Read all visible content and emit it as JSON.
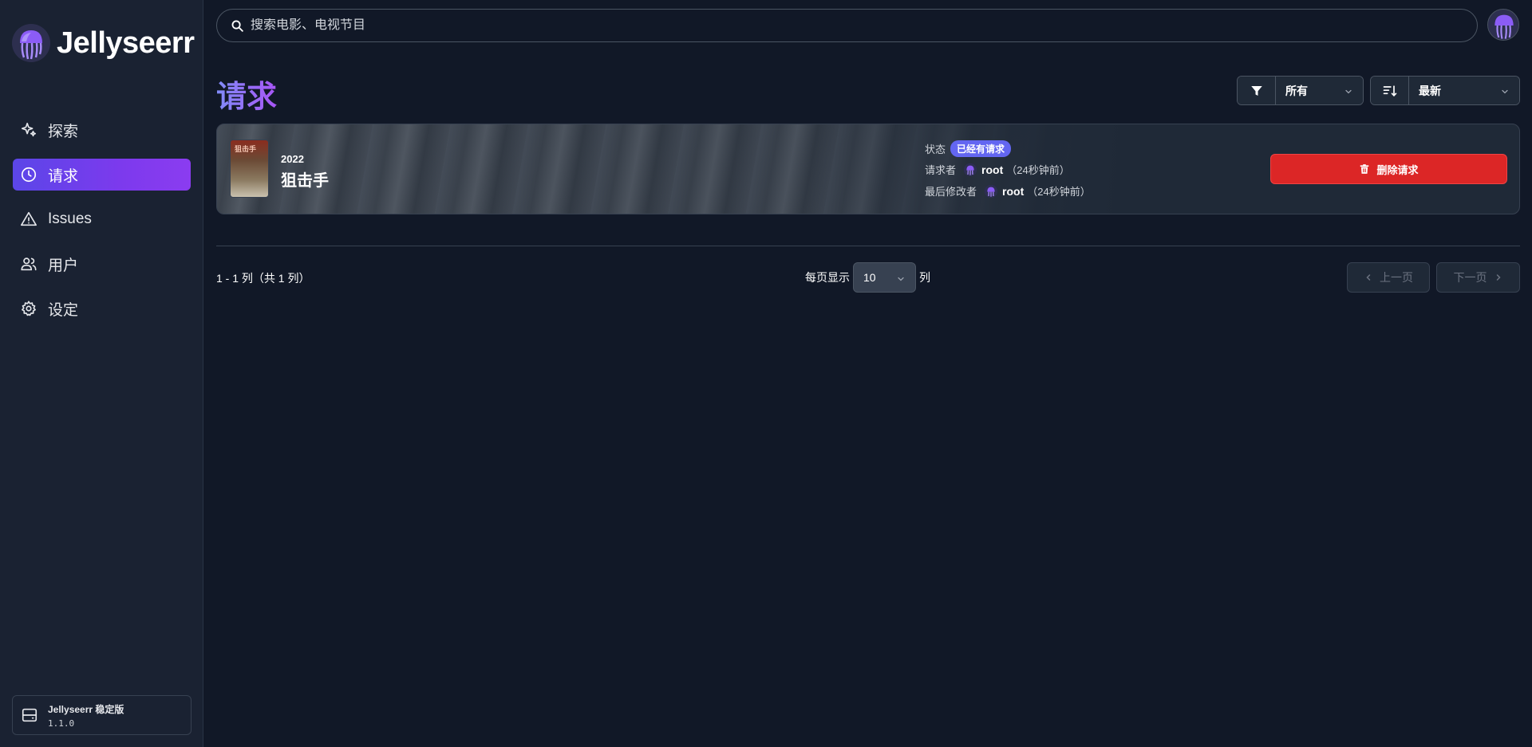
{
  "app": {
    "name": "Jellyseerr",
    "version_label": "Jellyseerr 稳定版",
    "version_number": "1.1.0"
  },
  "sidebar": {
    "items": [
      {
        "label": "探索",
        "icon": "sparkles-icon",
        "active": false
      },
      {
        "label": "请求",
        "icon": "clock-icon",
        "active": true
      },
      {
        "label": "Issues",
        "icon": "warning-icon",
        "active": false
      },
      {
        "label": "用户",
        "icon": "users-icon",
        "active": false
      },
      {
        "label": "设定",
        "icon": "gear-icon",
        "active": false
      }
    ]
  },
  "search": {
    "placeholder": "搜索电影、电视节目"
  },
  "page": {
    "title": "请求"
  },
  "filters": {
    "filter_value": "所有",
    "sort_value": "最新"
  },
  "requests": [
    {
      "year": "2022",
      "title": "狙击手",
      "poster_text": "狙击手",
      "status_label": "状态",
      "status_badge": "已经有请求",
      "requester_label": "请求者",
      "requester_name": "root",
      "requester_time": "（24秒钟前）",
      "modifier_label": "最后修改者",
      "modifier_name": "root",
      "modifier_time": "（24秒钟前）",
      "delete_label": "删除请求"
    }
  ],
  "pagination": {
    "range_text": "1 - 1 列（共 1 列）",
    "per_page_label": "每页显示",
    "per_page_value": "10",
    "per_page_suffix": "列",
    "prev_label": "上一页",
    "next_label": "下一页"
  },
  "colors": {
    "accent": "#7c3aed",
    "danger": "#dc2626",
    "badge": "#6366f1"
  }
}
